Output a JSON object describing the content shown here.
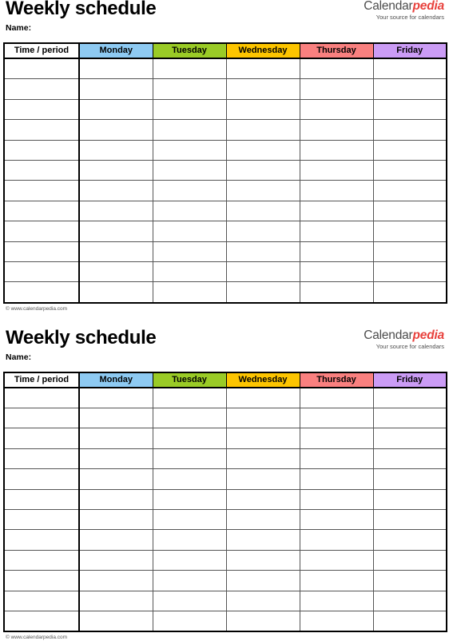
{
  "document": {
    "title": "Weekly schedule",
    "name_label": "Name:",
    "footer": "© www.calendarpedia.com"
  },
  "logo": {
    "brand_first": "Calendar",
    "brand_second": "pedia",
    "tagline": "Your source for calendars",
    "color_first": "#4d4d4d",
    "color_second": "#e8413c"
  },
  "table": {
    "columns": [
      {
        "label": "Time / period",
        "color": "#ffffff"
      },
      {
        "label": "Monday",
        "color": "#8ecaf2"
      },
      {
        "label": "Tuesday",
        "color": "#9acb26"
      },
      {
        "label": "Wednesday",
        "color": "#fdc500"
      },
      {
        "label": "Thursday",
        "color": "#f9807f"
      },
      {
        "label": "Friday",
        "color": "#cb9cf5"
      }
    ],
    "row_count": 12,
    "cells": [
      [
        "",
        "",
        "",
        "",
        "",
        ""
      ],
      [
        "",
        "",
        "",
        "",
        "",
        ""
      ],
      [
        "",
        "",
        "",
        "",
        "",
        ""
      ],
      [
        "",
        "",
        "",
        "",
        "",
        ""
      ],
      [
        "",
        "",
        "",
        "",
        "",
        ""
      ],
      [
        "",
        "",
        "",
        "",
        "",
        ""
      ],
      [
        "",
        "",
        "",
        "",
        "",
        ""
      ],
      [
        "",
        "",
        "",
        "",
        "",
        ""
      ],
      [
        "",
        "",
        "",
        "",
        "",
        ""
      ],
      [
        "",
        "",
        "",
        "",
        "",
        ""
      ],
      [
        "",
        "",
        "",
        "",
        "",
        ""
      ],
      [
        "",
        "",
        "",
        "",
        "",
        ""
      ]
    ]
  },
  "sheets": [
    {
      "id": "sheet-1"
    },
    {
      "id": "sheet-2"
    }
  ]
}
